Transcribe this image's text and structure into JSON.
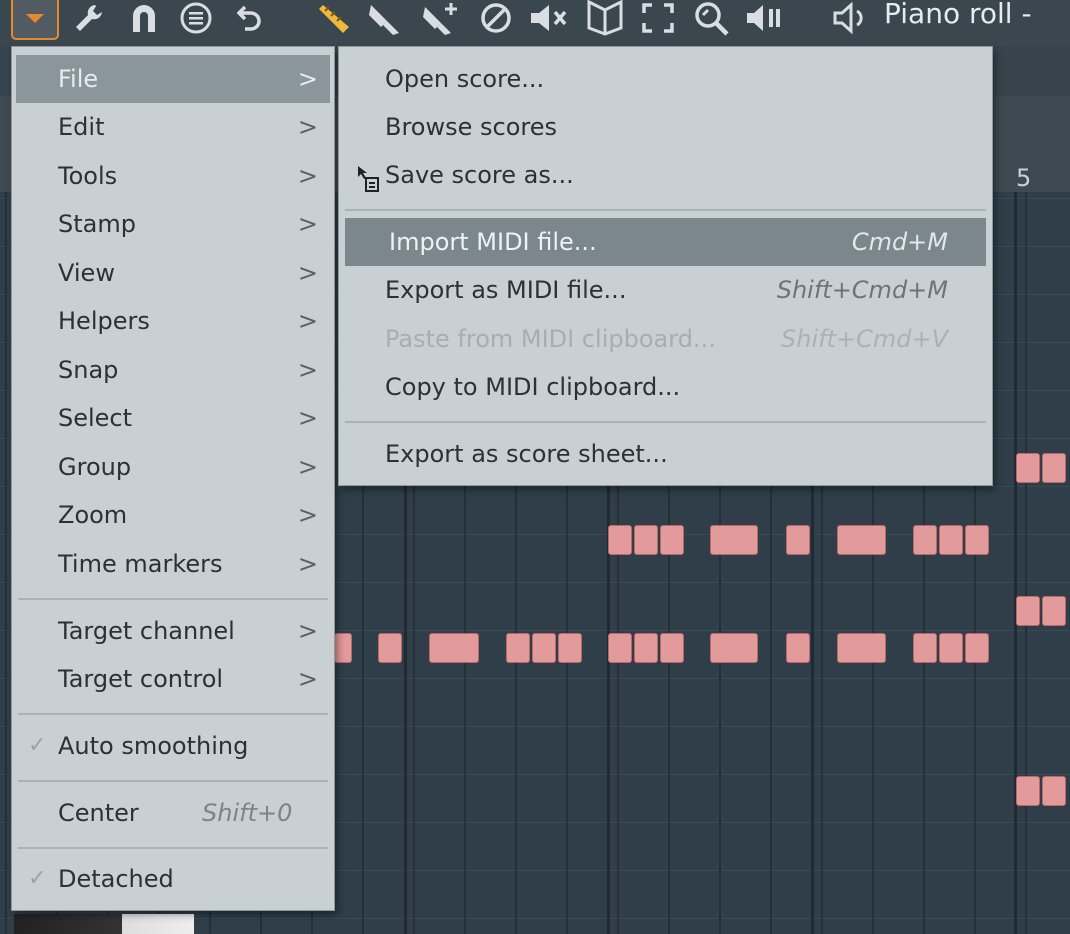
{
  "toolbar": {
    "title": "Piano roll -",
    "icons": [
      "dropdown-arrow-icon",
      "wrench-icon",
      "magnet-icon",
      "menu-circle-icon",
      "undo-icon",
      "pencil-icon",
      "paint-brush-icon",
      "paint-add-icon",
      "delete-icon",
      "mute-icon",
      "slice-icon",
      "select-icon",
      "zoom-icon",
      "playback-icon",
      "speaker-icon"
    ]
  },
  "ruler": {
    "bar_number": "5"
  },
  "main_menu": {
    "items": [
      {
        "label": "File",
        "submenu": true
      },
      {
        "label": "Edit",
        "submenu": true
      },
      {
        "label": "Tools",
        "submenu": true
      },
      {
        "label": "Stamp",
        "submenu": true
      },
      {
        "label": "View",
        "submenu": true
      },
      {
        "label": "Helpers",
        "submenu": true
      },
      {
        "label": "Snap",
        "submenu": true
      },
      {
        "label": "Select",
        "submenu": true
      },
      {
        "label": "Group",
        "submenu": true
      },
      {
        "label": "Zoom",
        "submenu": true
      },
      {
        "label": "Time markers",
        "submenu": true
      },
      {
        "label": "Target channel",
        "submenu": true
      },
      {
        "label": "Target control",
        "submenu": true
      },
      {
        "label": "Auto smoothing",
        "checked": true
      },
      {
        "label": "Center",
        "shortcut": "Shift+0"
      },
      {
        "label": "Detached",
        "checked": true
      }
    ],
    "check_glyph": "✓",
    "arrow_glyph": ">"
  },
  "file_menu": {
    "items": [
      {
        "label": "Open score..."
      },
      {
        "label": "Browse scores"
      },
      {
        "label": "Save score as..."
      },
      {
        "label": "Import MIDI file...",
        "shortcut": "Cmd+M"
      },
      {
        "label": "Export as MIDI file...",
        "shortcut": "Shift+Cmd+M"
      },
      {
        "label": "Paste from MIDI clipboard...",
        "shortcut": "Shift+Cmd+V",
        "disabled": true
      },
      {
        "label": "Copy to MIDI clipboard..."
      },
      {
        "label": "Export as score sheet..."
      }
    ]
  },
  "colors": {
    "accent": "#e48a2c",
    "note": "#e39a9a",
    "menu_bg": "#c9d0d4",
    "highlight": "#8a959c"
  }
}
